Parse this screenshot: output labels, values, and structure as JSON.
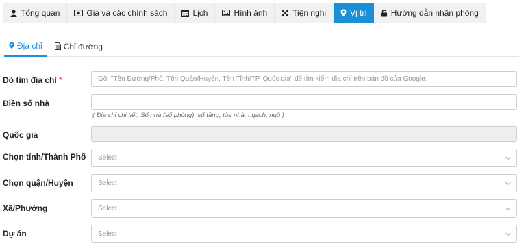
{
  "tabs": [
    {
      "label": "Tổng quan",
      "icon": "user-icon",
      "active": false
    },
    {
      "label": "Giá và các chính sách",
      "icon": "money-icon",
      "active": false
    },
    {
      "label": "Lịch",
      "icon": "calendar-icon",
      "active": false
    },
    {
      "label": "Hình ảnh",
      "icon": "image-icon",
      "active": false
    },
    {
      "label": "Tiện nghi",
      "icon": "amenities-icon",
      "active": true
    },
    {
      "label": "Vị trí",
      "icon": "map-marker-icon",
      "active": true
    },
    {
      "label": "Hướng dẫn nhận phòng",
      "icon": "lock-icon",
      "active": false
    }
  ],
  "subtabs": [
    {
      "label": "Địa chỉ",
      "icon": "map-marker-icon",
      "active": true
    },
    {
      "label": "Chỉ đường",
      "icon": "document-icon",
      "active": false
    }
  ],
  "form": {
    "search": {
      "label": "Dò tìm địa chỉ",
      "required_mark": "*",
      "placeholder": "Gõ: \"Tên Đường/Phố, Tên Quận/Huyện, Tên Tỉnh/TP, Quốc gia\" để tìm kiếm địa chỉ trên bản đồ của Google."
    },
    "house_number": {
      "label": "Điền số nhà",
      "value": "",
      "hint": "( Địa chỉ chi tiết: Số nhà (số phòng), số tầng, tòa nhà, ngách, ngõ )"
    },
    "country": {
      "label": "Quốc gia",
      "value": ""
    },
    "province": {
      "label": "Chọn tỉnh/Thành Phố",
      "placeholder": "Select"
    },
    "district": {
      "label": "Chọn quận/Huyện",
      "placeholder": "Select"
    },
    "ward": {
      "label": "Xã/Phường",
      "placeholder": "Select"
    },
    "project": {
      "label": "Dự án",
      "placeholder": "Select"
    }
  },
  "colors": {
    "accent": "#1a8fd8",
    "required": "#e03030"
  }
}
